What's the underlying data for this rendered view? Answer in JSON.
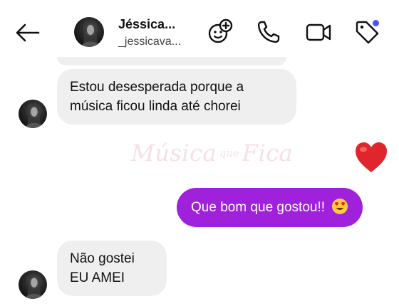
{
  "header": {
    "back_icon": "arrow-left-icon",
    "contact_name": "Jéssica...",
    "contact_handle": "_jessicava...",
    "icons": [
      "add-sticker-icon",
      "phone-icon",
      "video-camera-icon",
      "tag-icon"
    ],
    "tag_dot_color": "#4a52ff"
  },
  "messages": [
    {
      "direction": "incoming",
      "text": "Estou desesperada porque a música ficou linda até chorei"
    },
    {
      "direction": "outgoing",
      "reaction": "heart-emoji"
    },
    {
      "direction": "outgoing",
      "text": "Que bom que gostou!!",
      "emoji": "heart-eyes-emoji"
    },
    {
      "direction": "incoming",
      "lines": [
        "Não gostei",
        "EU AMEI"
      ]
    }
  ],
  "watermark": {
    "part1": "Música",
    "part2": "que",
    "part3": "Fica"
  },
  "colors": {
    "outgoing_bubble": "#a021dc",
    "incoming_bubble": "#efefef",
    "heart": "#e0262c"
  }
}
